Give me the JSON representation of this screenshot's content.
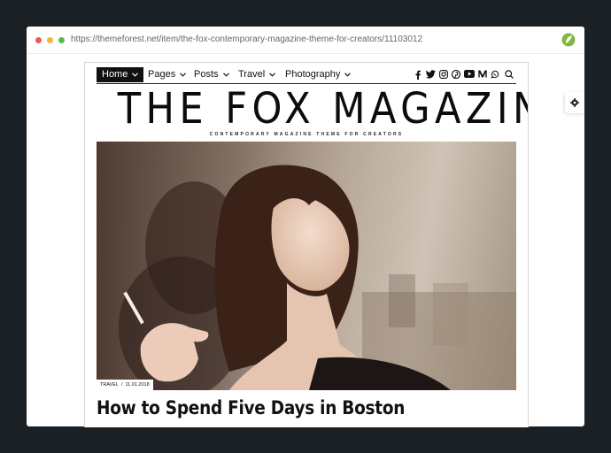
{
  "browser": {
    "url": "https://themeforest.net/item/the-fox-contemporary-magazine-theme-for-creators/11103012"
  },
  "nav": {
    "items": [
      {
        "label": "Home",
        "active": true
      },
      {
        "label": "Pages",
        "active": false
      },
      {
        "label": "Posts",
        "active": false
      },
      {
        "label": "Travel",
        "active": false
      },
      {
        "label": "Photography",
        "active": false
      }
    ],
    "social_icons": [
      "facebook-icon",
      "twitter-icon",
      "instagram-icon",
      "pinterest-icon",
      "youtube-icon",
      "medium-icon",
      "whatsapp-icon",
      "search-icon"
    ]
  },
  "site": {
    "title": "THE FOX MAGAZINE",
    "tagline": "CONTEMPORARY MAGAZINE THEME FOR CREATORS"
  },
  "featured_post": {
    "category": "TRAVEL",
    "separator": "/",
    "date": "11.01.2018",
    "title": "How to Spend Five Days in Boston"
  },
  "colors": {
    "page_bg": "#1a2024",
    "text": "#111111",
    "envato_green": "#82b541"
  }
}
